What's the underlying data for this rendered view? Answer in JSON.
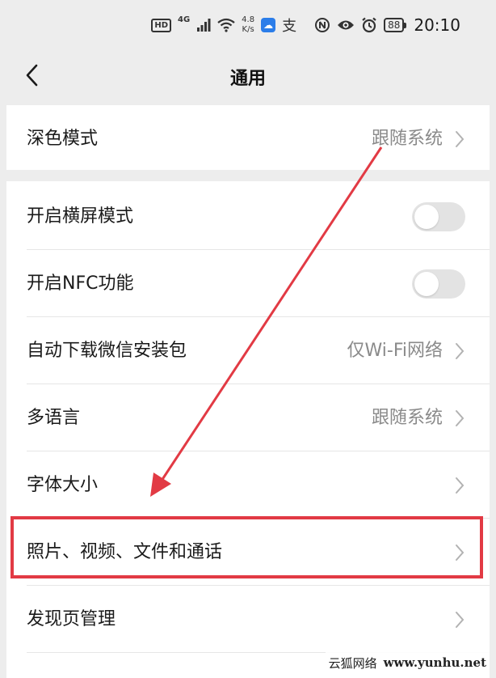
{
  "status_bar": {
    "hd": "HD",
    "network": "4G",
    "speed_value": "4.8",
    "speed_unit": "K/s",
    "alipay_glyph": "支",
    "battery": "88",
    "time": "20:10",
    "icons": [
      "hd-badge",
      "signal-icon",
      "wifi-icon",
      "cloud-app-icon",
      "alipay-icon",
      "nfc-icon",
      "eye-icon",
      "alarm-icon",
      "battery-icon"
    ]
  },
  "nav": {
    "back_icon": "chevron-left-icon",
    "title": "通用"
  },
  "groups": [
    {
      "rows": [
        {
          "label": "深色模式",
          "value": "跟随系统",
          "type": "link"
        }
      ]
    },
    {
      "rows": [
        {
          "label": "开启横屏模式",
          "type": "toggle",
          "on": false
        },
        {
          "label": "开启NFC功能",
          "type": "toggle",
          "on": false
        },
        {
          "label": "自动下载微信安装包",
          "value": "仅Wi-Fi网络",
          "type": "link"
        },
        {
          "label": "多语言",
          "value": "跟随系统",
          "type": "link"
        },
        {
          "label": "字体大小",
          "value": "",
          "type": "link"
        },
        {
          "label": "照片、视频、文件和通话",
          "value": "",
          "type": "link",
          "highlighted": true
        },
        {
          "label": "发现页管理",
          "value": "",
          "type": "link"
        }
      ]
    }
  ],
  "annotation": {
    "highlight_color": "#e23a44",
    "arrow_color": "#e23a44"
  },
  "watermark": {
    "chars": "云狐网络",
    "domain": "www.yunhu.net"
  }
}
